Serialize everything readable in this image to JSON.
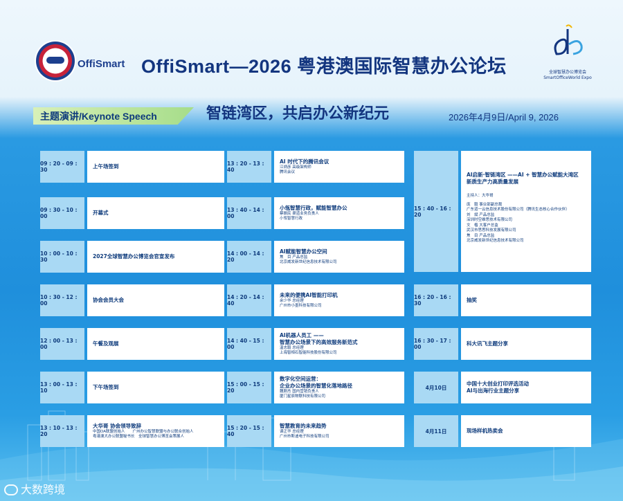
{
  "header": {
    "brand": "OffiSmart",
    "title": "OffiSmart—2026 粤港澳国际智慧办公论坛",
    "expo_cn": "全球智慧办公博览会",
    "expo_en": "SmartOfficeWorld Expo"
  },
  "banner": {
    "keynote": "主题演讲/Keynote Speech",
    "slogan": "智链湾区，共启办公新纪元",
    "date": "2026年4月9日/April 9, 2026"
  },
  "col1": [
    {
      "time": "09 : 20 - 09 : 30",
      "title": "上午场签到",
      "sub": []
    },
    {
      "time": "09 : 30 - 10 : 00",
      "title": "开幕式",
      "sub": []
    },
    {
      "time": "10 : 00 - 10 : 30",
      "title": "2027全球智慧办公博览会官宣发布",
      "sub": []
    },
    {
      "time": "10 : 30 - 12 : 00",
      "title": "协会会员大会",
      "sub": []
    },
    {
      "time": "12 : 00 - 13 : 00",
      "title": "午餐及观展",
      "sub": []
    },
    {
      "time": "13 : 00 - 13 : 10",
      "title": "下午场签到",
      "sub": []
    },
    {
      "time": "13 : 10 - 13 : 20",
      "title": "大华哥 协会领导致辞",
      "sub": [
        "中国OA联盟创始人　　广州办公智慧联盟与办公联合创始人",
        "粤港澳大办公联盟秘书长　全球智慧办公博览会策展人"
      ]
    }
  ],
  "col2": [
    {
      "time": "13 : 20 - 13 : 40",
      "title": "AI 时代下的腾讯会议",
      "sub": [
        "江炳彦 高级架构师",
        "腾讯会议"
      ]
    },
    {
      "time": "13 : 40 - 14 : 00",
      "title": "小瓴智慧行政，赋能智慧办公",
      "sub": [
        "蔡振民 渠道业务负责人",
        "小瓴智慧行政"
      ]
    },
    {
      "time": "14 : 00 - 14 : 20",
      "title": "AI赋能智慧办公空间",
      "sub": [
        "焦　目 产品总监",
        "北京威发新世纪信息技术有限公司"
      ]
    },
    {
      "time": "14 : 20 - 14 : 40",
      "title": "未来的便携AI智能打印机",
      "sub": [
        "余少华 总经理",
        "广州市小墨科技有限公司"
      ]
    },
    {
      "time": "14 : 40 - 15 : 00",
      "title": "AI机器人员工 ——",
      "title2": "智慧办公场景下的高效服务新范式",
      "sub": [
        "温志毅 总经理",
        "上海智相石智能科技股份有限公司"
      ]
    },
    {
      "time": "15 : 00 - 15 : 20",
      "title": "数字化空间运营：",
      "title2": "企业办公场景的智慧化落地路径",
      "sub": [
        "魏刚杰 国内营销负责人",
        "厦门星辰物联科技有限公司"
      ]
    },
    {
      "time": "15 : 20 - 15 : 40",
      "title": "智慧教育的未来趋势",
      "sub": [
        "谭正华 总经理",
        "广州市斯迪电子科技有限公司"
      ]
    }
  ],
  "col3_big": {
    "time": "15 : 40 - 16 : 20",
    "title": "AI启新·智链湾区 ——AI + 智慧办公赋能大湾区",
    "title2": "新质生产力高质量发展",
    "lines": [
      "主持人：大华哥",
      "",
      "庞　毅 事业部副总裁",
      "广东道一云信息技术股份有限公司（腾讯生态核心合作伙伴）",
      "刘　斌 产品总监",
      "深圳时空维思技术有限公司",
      "文　楷 大客户总监",
      "武汉市思思科技发展有限公司",
      "焦　目 产品总监",
      "北京威发新世纪信息技术有限公司"
    ]
  },
  "col3": [
    {
      "time": "16 : 20 - 16 : 30",
      "title": "抽奖",
      "sub": []
    },
    {
      "time": "16 : 30 - 17 : 00",
      "title": "科大讯飞主题分享",
      "sub": []
    },
    {
      "time": "4月10日",
      "title": "中国十大创业打印评选活动",
      "title2": "AI与出海行业主题分享",
      "sub": []
    },
    {
      "time": "4月11日",
      "title": "现场样机热卖会",
      "sub": []
    }
  ],
  "watermark": "大数跨境",
  "colors": {
    "navy": "#13357f",
    "cell_time": "#a9d9f4",
    "bg_blue": "#1f8fdc",
    "keynote_green": "#a6dd8a"
  }
}
